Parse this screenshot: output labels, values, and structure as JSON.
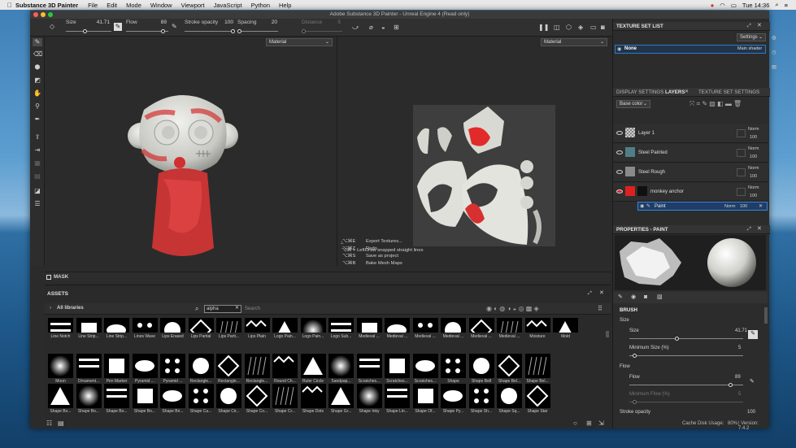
{
  "menubar": {
    "app_name": "Substance 3D Painter",
    "items": [
      "File",
      "Edit",
      "Mode",
      "Window",
      "Viewport",
      "JavaScript",
      "Python",
      "Help"
    ],
    "clock": "Tue 14:36"
  },
  "window": {
    "title": "Adobe Substance 3D Painter - Unreal Engine 4 (Read only)"
  },
  "toolbar": {
    "size_label": "Size",
    "size_value": "41.71",
    "size_fraction": 0.42,
    "flow_label": "Flow",
    "flow_value": "89",
    "flow_fraction": 0.89,
    "stroke_opacity_label": "Stroke opacity",
    "stroke_opacity_value": "100",
    "stroke_opacity_fraction": 1.0,
    "spacing_label": "Spacing",
    "spacing_value": "20",
    "spacing_fraction": 0.06,
    "distance_label": "Distance",
    "distance_value": "5",
    "distance_fraction": 0.05
  },
  "viewport": {
    "material_left": "Material",
    "material_right": "Material",
    "mask_label": "MASK"
  },
  "shortcuts": [
    {
      "keys": "⌥⌘E",
      "label": "Export Textures..."
    },
    {
      "keys": "⌥⌘Z",
      "label": "Redo"
    },
    {
      "keys": "⌥⌘S",
      "label": "Save as project"
    },
    {
      "keys": "⌥⌘B",
      "label": "Bake Mesh Maps"
    }
  ],
  "hint": {
    "keys": "⌥⌘ + Left",
    "label": "Draw snapped straight lines"
  },
  "assets": {
    "title": "ASSETS",
    "library": "All libraries",
    "search_value": "alpha",
    "search_placeholder": "Search",
    "row1": [
      "Line Notch",
      "Line Strip...",
      "Line Strip...",
      "Lines Wave",
      "Lips Erased",
      "Lips Partial",
      "Lips Parti...",
      "Lips Plain",
      "Logo Pain...",
      "Logo Pain...",
      "Logo Sub...",
      "Medieval ...",
      "Medieval ...",
      "Medieval ...",
      "Medieval ...",
      "Medieval ...",
      "Medieval ...",
      "Moisture",
      "Mold"
    ],
    "row2": [
      "Moon",
      "Ornament...",
      "Pen Marker",
      "Pyramid ...",
      "Pyramid ...",
      "Rectangle...",
      "Rectangle...",
      "Rectangle...",
      "Round Ch...",
      "Ruler Circle",
      "Sandpap...",
      "Scratches...",
      "Scratches...",
      "Scratches...",
      "Shape",
      "Shape Bell",
      "Shape Bel...",
      "Shape Bel..."
    ],
    "row3": [
      "Shape Bo...",
      "Shape Bo...",
      "Shape Bo...",
      "Shape Bo...",
      "Shape Bri...",
      "Shape Ca...",
      "Shape Cir...",
      "Shape Co...",
      "Shape Cr...",
      "Shape Dots",
      "Shape Gr...",
      "Shape Inky",
      "Shape Lin...",
      "Shape Of...",
      "Shape Py...",
      "Shape Sh...",
      "Shape Sq...",
      "Shape Star"
    ]
  },
  "texture_set_list": {
    "title": "TEXTURE SET LIST",
    "settings": "Settings",
    "item_name": "None",
    "item_shader": "Main shader"
  },
  "layers_panel": {
    "tab_display": "DISPLAY SETTINGS",
    "tab_layers": "LAYERS",
    "tab_texture": "TEXTURE SET SETTINGS",
    "channel": "Base color",
    "layers": [
      {
        "name": "Layer 1",
        "blend": "Norm",
        "opacity": "100"
      },
      {
        "name": "Steel Painted",
        "blend": "Norm",
        "opacity": "100"
      },
      {
        "name": "Steel Rough",
        "blend": "Norm",
        "opacity": "100"
      },
      {
        "name": "monkey anchor",
        "blend": "Norm",
        "opacity": "100"
      }
    ],
    "sublayer": {
      "name": "Paint",
      "blend": "Norm",
      "opacity": "100"
    }
  },
  "properties": {
    "title": "PROPERTIES - PAINT",
    "brush_label": "BRUSH",
    "size_section": "Size",
    "size_label": "Size",
    "size_value": "41.71",
    "size_fraction": 0.42,
    "min_size_label": "Minimum Size (%)",
    "min_size_value": "5",
    "min_size_fraction": 0.05,
    "flow_section": "Flow",
    "flow_label": "Flow",
    "flow_value": "89",
    "flow_fraction": 0.89,
    "min_flow_label": "Minimum Flow (%)",
    "min_flow_value": "5",
    "min_flow_fraction": 0.05,
    "stroke_opacity_label": "Stroke opacity",
    "stroke_opacity_value": "100"
  },
  "status": {
    "cache_label": "Cache Disk Usage:",
    "cache_value": "80%",
    "version": "| Version: 7.4.2"
  },
  "colors": {
    "accent_red": "#e02020",
    "selection_blue": "#2f79c7",
    "panel_bg": "#2c2c2c"
  }
}
